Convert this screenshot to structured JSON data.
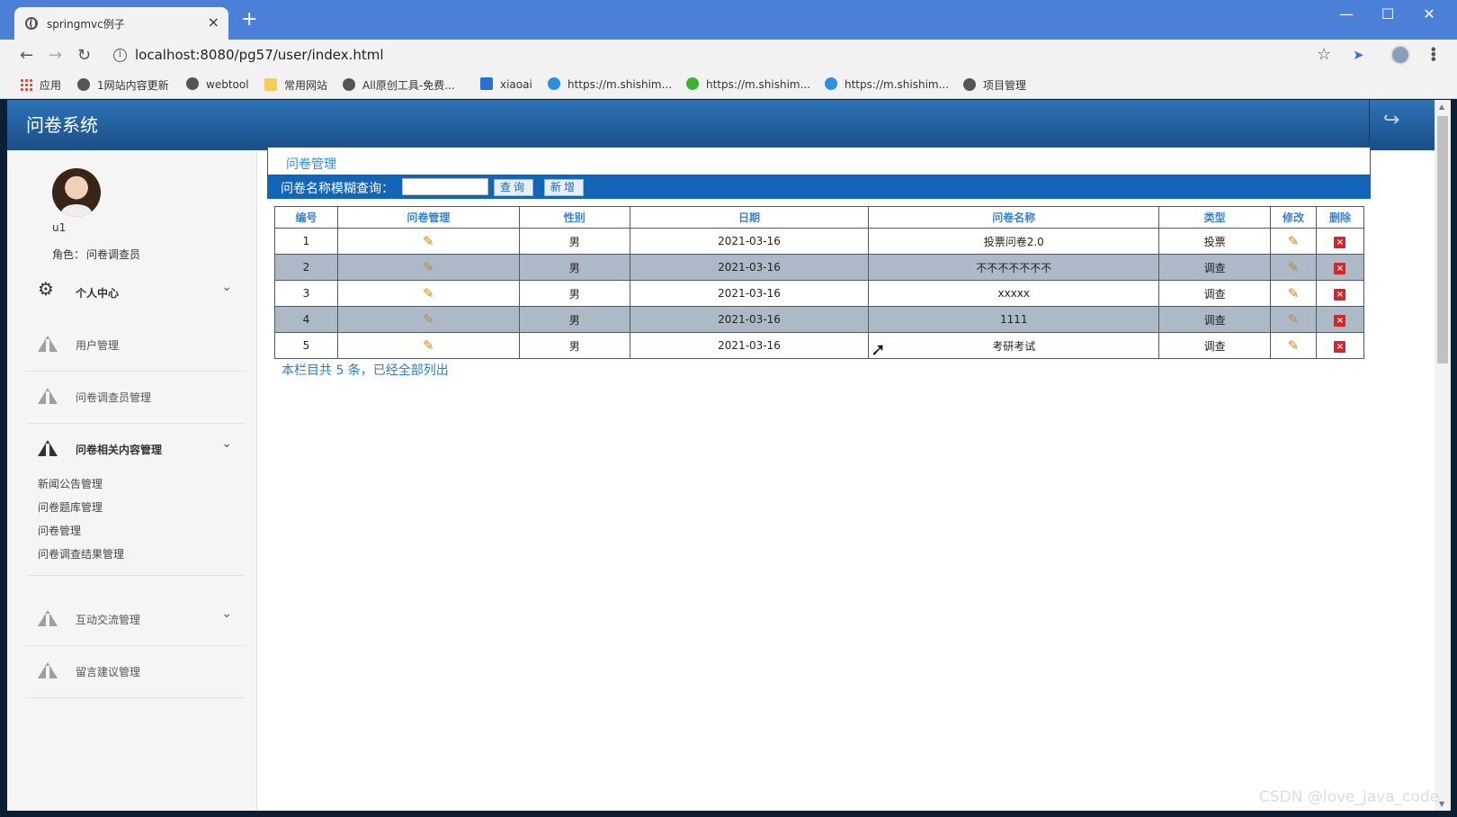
{
  "browser": {
    "tab_title": "springmvc例子",
    "tab_close": "×",
    "new_tab": "+",
    "url": "localhost:8080/pg57/user/index.html",
    "window_controls": {
      "minimize": "—",
      "maximize": "☐",
      "close": "✕"
    },
    "nav": {
      "back": "←",
      "forward": "→",
      "reload": "↻"
    },
    "bookmarks": [
      {
        "label": "应用",
        "icon": "apps-icon"
      },
      {
        "label": "1网站内容更新",
        "icon": "globe-icon"
      },
      {
        "label": "webtool",
        "icon": "globe-icon"
      },
      {
        "label": "常用网站",
        "icon": "folder-icon"
      },
      {
        "label": "All原创工具-免费...",
        "icon": "globe-icon"
      },
      {
        "label": "xiaoai",
        "icon": "p-icon"
      },
      {
        "label": "https://m.shishim...",
        "icon": "c-icon"
      },
      {
        "label": "https://m.shishim...",
        "icon": "wechat-icon"
      },
      {
        "label": "https://m.shishim...",
        "icon": "c-icon"
      },
      {
        "label": "项目管理",
        "icon": "globe-icon"
      }
    ]
  },
  "app": {
    "title": "问卷系统",
    "logout_icon": "↪"
  },
  "sidebar": {
    "username": "u1",
    "role_label": "角色：",
    "role_value": "问卷调查员",
    "menu": [
      {
        "label": "个人中心",
        "icon": "gear-icon",
        "expandable": true
      },
      {
        "label": "用户管理",
        "icon": "road-icon"
      },
      {
        "label": "问卷调查员管理",
        "icon": "road-icon"
      },
      {
        "label": "问卷相关内容管理",
        "icon": "road-icon",
        "expandable": true
      },
      {
        "label": "互动交流管理",
        "icon": "road-icon",
        "expandable": true
      },
      {
        "label": "留言建议管理",
        "icon": "road-icon"
      }
    ],
    "submenu": [
      "新闻公告管理",
      "问卷题库管理",
      "问卷管理",
      "问卷调查结果管理"
    ],
    "chevron": "⌄"
  },
  "main": {
    "panel_title": "问卷管理",
    "search_label": "问卷名称模糊查询：",
    "search_value": "",
    "search_button": "查询",
    "add_button": "新增",
    "table": {
      "headers": [
        "编号",
        "问卷管理",
        "性别",
        "日期",
        "问卷名称",
        "类型",
        "修改",
        "删除"
      ],
      "rows": [
        {
          "id": "1",
          "gender": "男",
          "date": "2021-03-16",
          "name": "投票问卷2.0",
          "type": "投票"
        },
        {
          "id": "2",
          "gender": "男",
          "date": "2021-03-16",
          "name": "不不不不不不不",
          "type": "调查"
        },
        {
          "id": "3",
          "gender": "男",
          "date": "2021-03-16",
          "name": "xxxxx",
          "type": "调查"
        },
        {
          "id": "4",
          "gender": "男",
          "date": "2021-03-16",
          "name": "1111",
          "type": "调查"
        },
        {
          "id": "5",
          "gender": "男",
          "date": "2021-03-16",
          "name": "考研考试",
          "type": "调查"
        }
      ],
      "edit_icon": "✎",
      "delete_icon": "×"
    },
    "summary": "本栏目共 5 条，已经全部列出"
  },
  "watermark": "CSDN @love_java_code",
  "colors": {
    "header": "#1a4e86",
    "search_bar": "#1365b8",
    "accent_text": "#2e8be0",
    "alt_row": "#adb9c7",
    "delete": "#d9252a"
  }
}
